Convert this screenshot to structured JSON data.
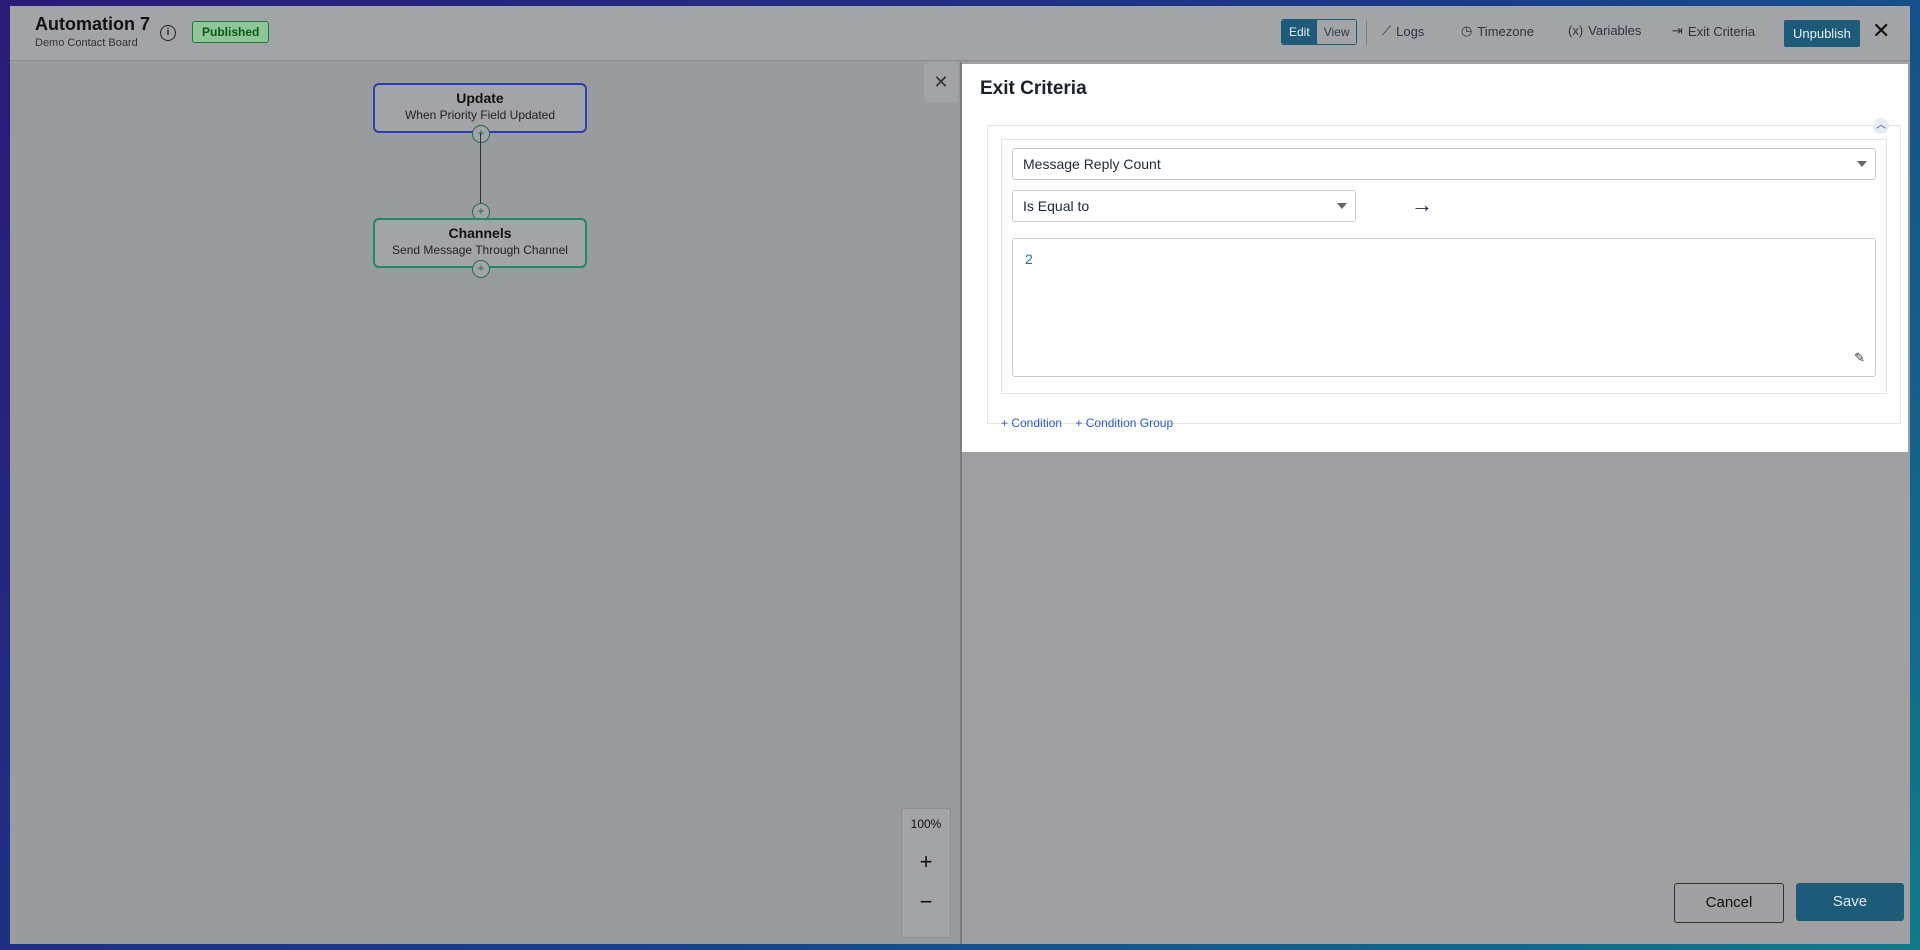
{
  "header": {
    "title": "Automation 7",
    "subtitle": "Demo Contact Board",
    "status_badge": "Published",
    "edit_label": "Edit",
    "view_label": "View",
    "logs_label": "Logs",
    "timezone_label": "Timezone",
    "variables_label": "Variables",
    "variables_icon": "(x)",
    "exit_criteria_label": "Exit Criteria",
    "unpublish_label": "Unpublish",
    "close_glyph": "✕"
  },
  "canvas": {
    "nodes": [
      {
        "title": "Update",
        "subtitle": "When Priority Field Updated"
      },
      {
        "title": "Channels",
        "subtitle": "Send Message Through Channel"
      }
    ],
    "plus_glyph": "+",
    "close_glyph": "✕",
    "zoom": {
      "level": "100%",
      "in": "+",
      "out": "−"
    }
  },
  "exit_panel": {
    "title": "Exit Criteria",
    "field_select": "Message Reply Count",
    "operator_select": "Is Equal to",
    "arrow": "→",
    "value": "2",
    "add_condition": "+ Condition",
    "add_condition_group": "+ Condition Group"
  },
  "footer": {
    "cancel_label": "Cancel",
    "save_label": "Save"
  },
  "colors": {
    "primary": "#1d5b78",
    "badge_green": "#1f7a2e",
    "node_update_border": "#2c3fb0",
    "node_channels_border": "#1f8a6a",
    "link_blue": "#2a5ad0"
  }
}
